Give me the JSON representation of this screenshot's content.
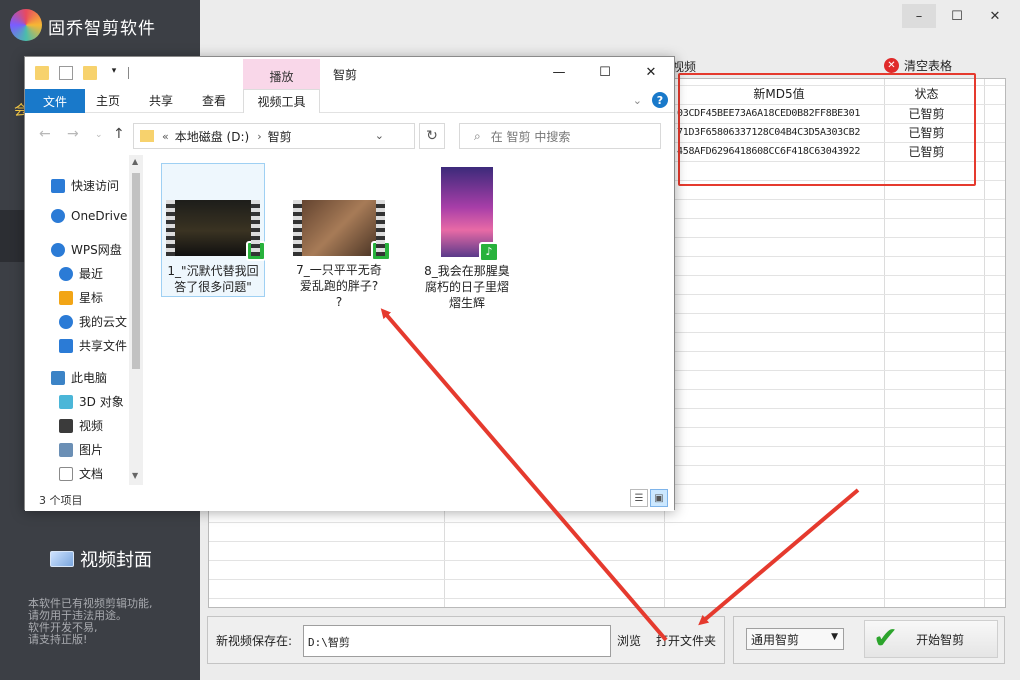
{
  "app": {
    "title": "固乔智剪软件",
    "sidebar_partial": "会",
    "sidebar_cover_label": "视频封面",
    "notice_lines": [
      "本软件已有视频剪辑功能,",
      "请勿用于违法用途。",
      "软件开发不易,",
      "请支持正版!"
    ]
  },
  "window_controls": {
    "minimize": "–",
    "maximize": "☐",
    "close": "✕"
  },
  "table": {
    "video_col_partial": "视频",
    "clear_button": "清空表格",
    "headers": {
      "md5": "新MD5值",
      "status": "状态"
    },
    "rows": [
      {
        "md5": "03CDF45BEE73A6A18CED0B82FF8BE301",
        "status": "已智剪"
      },
      {
        "md5": "71D3F65806337128C04B4C3D5A303CB2",
        "status": "已智剪"
      },
      {
        "md5": "458AFD6296418608CC6F418C63043922",
        "status": "已智剪"
      }
    ]
  },
  "bottom": {
    "save_label": "新视频保存在:",
    "save_path": "D:\\智剪",
    "browse": "浏览",
    "open_folder": "打开文件夹",
    "mode": "通用智剪",
    "start": "开始智剪"
  },
  "explorer": {
    "context_tab": "播放",
    "title": "智剪",
    "controls": {
      "minimize": "—",
      "maximize": "☐",
      "close": "✕"
    },
    "ribbon_tabs": [
      "文件",
      "主页",
      "共享",
      "查看",
      "视频工具"
    ],
    "address": {
      "root": "本地磁盘 (D:)",
      "folder": "智剪"
    },
    "search_placeholder": "在 智剪 中搜索",
    "nav_items": [
      {
        "label": "快速访问",
        "color": "#2b7bd6"
      },
      {
        "label": "OneDrive",
        "color": "#2b7bd6"
      },
      {
        "label": "WPS网盘",
        "color": "#2b7bd6"
      },
      {
        "label": "最近",
        "color": "#2b7bd6"
      },
      {
        "label": "星标",
        "color": "#f2a516"
      },
      {
        "label": "我的云文",
        "color": "#2b7bd6"
      },
      {
        "label": "共享文件",
        "color": "#2b7bd6"
      },
      {
        "label": "此电脑",
        "color": "#3b83c6"
      },
      {
        "label": "3D 对象",
        "color": "#4bb6d8"
      },
      {
        "label": "视频",
        "color": "#3b3b3b"
      },
      {
        "label": "图片",
        "color": "#6b8fb5"
      },
      {
        "label": "文档",
        "color": "#8a8a8a"
      }
    ],
    "files": [
      {
        "name_line1": "1_\"沉默代替我回",
        "name_line2": "答了很多问题\"",
        "name_line3": ""
      },
      {
        "name_line1": "7_一只平平无奇",
        "name_line2": "爱乱跑的胖子?",
        "name_line3": "?"
      },
      {
        "name_line1": "8_我会在那腥臭",
        "name_line2": "腐朽的日子里熠",
        "name_line3": "熠生辉"
      }
    ],
    "status": "3 个项目"
  }
}
